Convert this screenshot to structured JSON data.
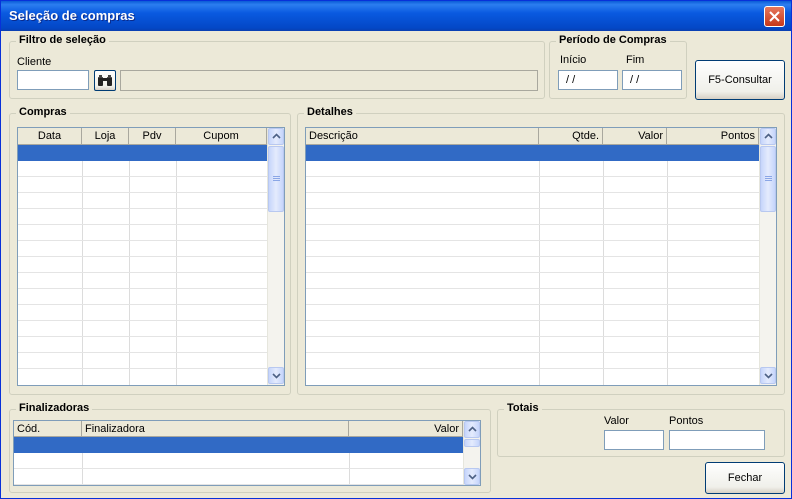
{
  "window": {
    "title": "Seleção de compras"
  },
  "filtro": {
    "title": "Filtro de seleção",
    "cliente_label": "Cliente",
    "cliente_value": ""
  },
  "periodo": {
    "title": "Período de Compras",
    "inicio_label": "Início",
    "inicio_value": " / /",
    "fim_label": "Fim",
    "fim_value": " / /"
  },
  "actions": {
    "consultar": "F5-Consultar",
    "fechar": "Fechar"
  },
  "compras": {
    "title": "Compras",
    "columns": [
      "Data",
      "Loja",
      "Pdv",
      "Cupom"
    ]
  },
  "detalhes": {
    "title": "Detalhes",
    "columns": [
      "Descrição",
      "Qtde.",
      "Valor",
      "Pontos"
    ]
  },
  "finalizadoras": {
    "title": "Finalizadoras",
    "columns": [
      "Cód.",
      "Finalizadora",
      "Valor"
    ]
  },
  "totais": {
    "title": "Totais",
    "valor_label": "Valor",
    "valor_value": "",
    "pontos_label": "Pontos",
    "pontos_value": ""
  },
  "colors": {
    "titlebar": "#0a5ae0",
    "selection": "#316ac5",
    "face": "#ece9d8"
  },
  "icons": {
    "close": "close-icon",
    "lookup": "binoculars-icon",
    "scroll_up": "chevron-up-icon",
    "scroll_down": "chevron-down-icon"
  }
}
